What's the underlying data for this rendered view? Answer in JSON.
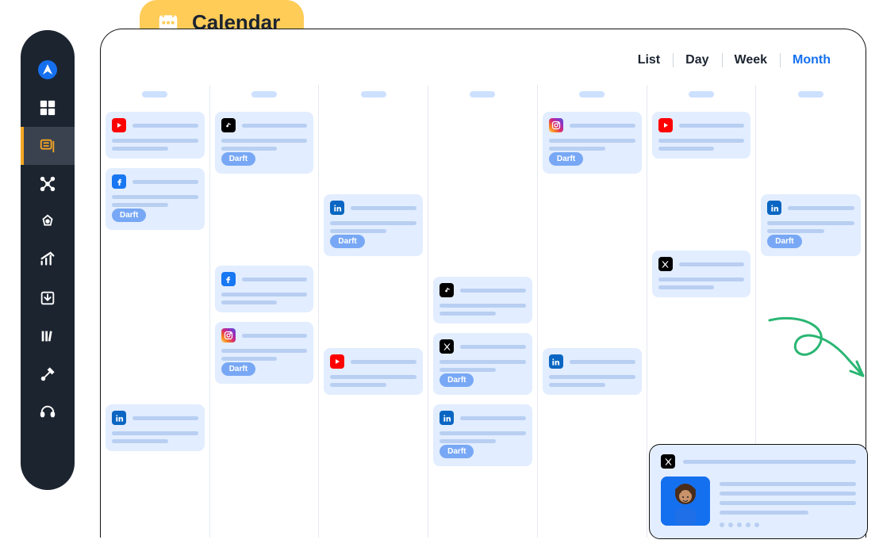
{
  "header": {
    "title": "Calendar"
  },
  "viewTabs": [
    "List",
    "Day",
    "Week",
    "Month"
  ],
  "activeView": "Month",
  "draftLabel": "Darft",
  "columns": [
    {
      "cards": [
        {
          "platform": "youtube",
          "draft": false
        },
        {
          "platform": "facebook",
          "draft": true
        },
        null,
        null,
        {
          "platform": "linkedin",
          "draft": false
        }
      ]
    },
    {
      "cards": [
        {
          "platform": "tiktok",
          "draft": true
        },
        null,
        {
          "platform": "facebook",
          "draft": false
        },
        {
          "platform": "instagram",
          "draft": true
        }
      ]
    },
    {
      "cards": [
        null,
        {
          "platform": "linkedin",
          "draft": true
        },
        null,
        {
          "platform": "youtube",
          "draft": false
        }
      ]
    },
    {
      "cards": [
        null,
        null,
        {
          "platform": "tiktok",
          "draft": false
        },
        {
          "platform": "x",
          "draft": true
        },
        {
          "platform": "linkedin",
          "draft": true
        }
      ]
    },
    {
      "cards": [
        {
          "platform": "instagram",
          "draft": true
        },
        null,
        null,
        {
          "platform": "linkedin",
          "draft": false
        }
      ]
    },
    {
      "cards": [
        {
          "platform": "youtube",
          "draft": false
        },
        null,
        {
          "platform": "x",
          "draft": false
        }
      ]
    },
    {
      "cards": [
        null,
        {
          "platform": "linkedin",
          "draft": true
        }
      ]
    }
  ],
  "preview": {
    "platform": "x",
    "dots": 5
  },
  "sidebarIcons": [
    "navigate",
    "dashboard",
    "comments",
    "connections",
    "target",
    "analytics",
    "download",
    "library",
    "tools",
    "support"
  ],
  "activeSidebarIndex": 2
}
